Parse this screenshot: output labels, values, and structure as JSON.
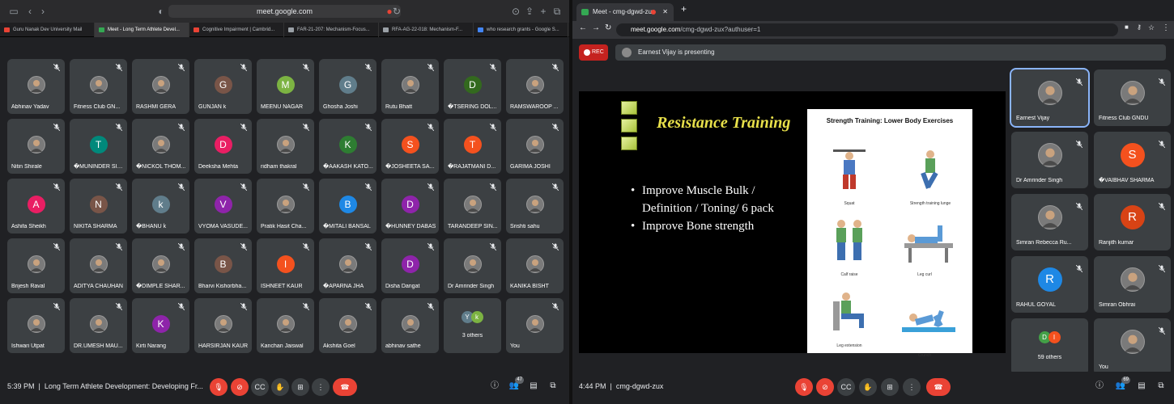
{
  "left": {
    "url": "meet.google.com",
    "tabs": [
      {
        "label": "Guru Nanak Dev University Mail",
        "color": "#ea4335"
      },
      {
        "label": "Meet - Long Term Athlete Devel...",
        "color": "#34a853"
      },
      {
        "label": "Cognitive Impairment | Cambrid...",
        "color": "#ea4335"
      },
      {
        "label": "FAR-21-207: Mechanism-Focus...",
        "color": "#9aa0a6"
      },
      {
        "label": "RFA-AG-22-018: Mechanism-F...",
        "color": "#9aa0a6"
      },
      {
        "label": "who research grants - Google S...",
        "color": "#4285f4"
      }
    ],
    "tiles": [
      {
        "name": "Abhinav Yadav",
        "initial": "",
        "color": "photo"
      },
      {
        "name": "Fitness Club GN...",
        "initial": "",
        "color": "photo"
      },
      {
        "name": "RASHMI GERA",
        "initial": "",
        "color": "photo"
      },
      {
        "name": "GUNJAN k",
        "initial": "G",
        "color": "#795548"
      },
      {
        "name": "MEENU NAGAR",
        "initial": "M",
        "color": "#7cb342"
      },
      {
        "name": "Ghosha Joshi",
        "initial": "G",
        "color": "#607d8b"
      },
      {
        "name": "Rutu Bhatt",
        "initial": "",
        "color": "photo"
      },
      {
        "name": "�TSERING DOL...",
        "initial": "D",
        "color": "#33691e"
      },
      {
        "name": "RAMSWAROOP ...",
        "initial": "",
        "color": "photo"
      },
      {
        "name": "Nitin Shirale",
        "initial": "",
        "color": "photo"
      },
      {
        "name": "�MUNINDER SIN...",
        "initial": "T",
        "color": "#00897b"
      },
      {
        "name": "�NICKOL THOM...",
        "initial": "",
        "color": "photo"
      },
      {
        "name": "Deeksha Mehta",
        "initial": "D",
        "color": "#e91e63"
      },
      {
        "name": "ridham thakral",
        "initial": "",
        "color": "photo"
      },
      {
        "name": "�AAKASH KATO...",
        "initial": "K",
        "color": "#2e7d32"
      },
      {
        "name": "�JOSHEETA SAT...",
        "initial": "S",
        "color": "#f4511e"
      },
      {
        "name": "�RAJATMANI D...",
        "initial": "T",
        "color": "#f4511e"
      },
      {
        "name": "GARIMA JOSHI",
        "initial": "",
        "color": "photo"
      },
      {
        "name": "Ashifa Sheikh",
        "initial": "A",
        "color": "#e91e63"
      },
      {
        "name": "NIKITA SHARMA",
        "initial": "N",
        "color": "#795548"
      },
      {
        "name": "�BHANU k",
        "initial": "k",
        "color": "#607d8b"
      },
      {
        "name": "VYOMA VASUDE...",
        "initial": "V",
        "color": "#8e24aa"
      },
      {
        "name": "Pratik Hasit Cha...",
        "initial": "",
        "color": "photo"
      },
      {
        "name": "�MITALI BANSAL",
        "initial": "B",
        "color": "#1e88e5"
      },
      {
        "name": "�HUNNEY DABAS",
        "initial": "D",
        "color": "#8e24aa"
      },
      {
        "name": "TARANDEEP SIN...",
        "initial": "",
        "color": "photo"
      },
      {
        "name": "Srishti sahu",
        "initial": "",
        "color": "photo"
      },
      {
        "name": "Brijesh Raval",
        "initial": "",
        "color": "photo"
      },
      {
        "name": "ADITYA CHAUHAN",
        "initial": "",
        "color": "photo"
      },
      {
        "name": "�DIMPLE SHAR...",
        "initial": "",
        "color": "photo"
      },
      {
        "name": "Bharvi Kishorbha...",
        "initial": "B",
        "color": "#795548"
      },
      {
        "name": "ISHNEET KAUR",
        "initial": "I",
        "color": "#f4511e"
      },
      {
        "name": "�APARNA JHA",
        "initial": "",
        "color": "photo"
      },
      {
        "name": "Disha Dangat",
        "initial": "D",
        "color": "#8e24aa"
      },
      {
        "name": "Dr Amrinder Singh",
        "initial": "",
        "color": "photo"
      },
      {
        "name": "KANIKA BISHT",
        "initial": "",
        "color": "photo"
      },
      {
        "name": "Ishwari Utpat",
        "initial": "",
        "color": "photo"
      },
      {
        "name": "DR.UMESH MAU...",
        "initial": "",
        "color": "photo"
      },
      {
        "name": "Kirti Narang",
        "initial": "K",
        "color": "#8e24aa"
      },
      {
        "name": "HARSIRJAN KAUR",
        "initial": "",
        "color": "photo"
      },
      {
        "name": "Kanchan Jaiswal",
        "initial": "",
        "color": "photo"
      },
      {
        "name": "Akshita Goel",
        "initial": "",
        "color": "photo"
      },
      {
        "name": "abhinav sathe",
        "initial": "",
        "color": "photo"
      },
      {
        "name": "3 others",
        "initial": "",
        "color": "others"
      },
      {
        "name": "You",
        "initial": "",
        "color": "photo"
      }
    ],
    "others_initials": [
      "Y",
      "k"
    ],
    "time": "5:39 PM",
    "meeting": "Long Term Athlete Development: Developing Fr...",
    "people_count": "47"
  },
  "right": {
    "tab_title": "Meet - cmg-dgwd-zux",
    "url_host": "meet.google.com",
    "url_path": "/cmg-dgwd-zux?authuser=1",
    "rec": "REC",
    "presenting": "Earnest Vijay is presenting",
    "slide": {
      "title": "Resistance Training",
      "bullets": [
        [
          "Improve Muscle Bulk /",
          "Definition / Toning/ 6 pack"
        ],
        [
          "Improve Bone strength"
        ]
      ],
      "figure_title": "Strength Training: Lower Body Exercises",
      "exercises": [
        "Squat",
        "Strength training lunge",
        "Calf raise",
        "Leg curl",
        "Leg extension",
        "Crunch"
      ]
    },
    "tiles": [
      {
        "name": "Earnest Vijay",
        "initial": "",
        "color": "photo"
      },
      {
        "name": "Fitness Club GNDU",
        "initial": "",
        "color": "photo"
      },
      {
        "name": "Dr Amrinder Singh",
        "initial": "",
        "color": "photo"
      },
      {
        "name": "�VAIBHAV SHARMA",
        "initial": "S",
        "color": "#f4511e"
      },
      {
        "name": "Simran Rebecca Ru...",
        "initial": "",
        "color": "photo"
      },
      {
        "name": "Ranjith kumar",
        "initial": "R",
        "color": "#d84315"
      },
      {
        "name": "RAHUL GOYAL",
        "initial": "R",
        "color": "#1e88e5"
      },
      {
        "name": "Simran Obhrai",
        "initial": "",
        "color": "photo"
      },
      {
        "name": "59 others",
        "initial": "",
        "color": "others"
      },
      {
        "name": "You",
        "initial": "",
        "color": "photo"
      }
    ],
    "others_initials": [
      "D",
      "I"
    ],
    "time": "4:44 PM",
    "meeting": "cmg-dgwd-zux",
    "people_count": "69"
  }
}
